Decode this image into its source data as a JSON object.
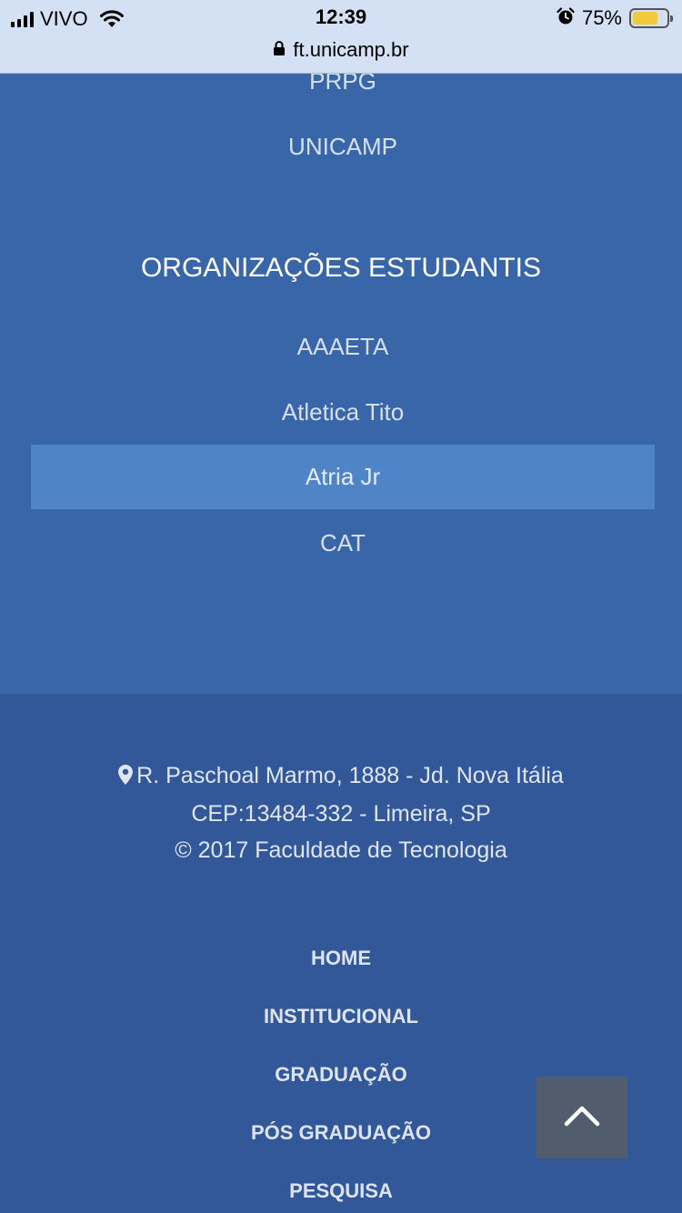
{
  "status_bar": {
    "carrier": "VIVO",
    "time": "12:39",
    "battery_percent": "75%",
    "battery_level": 0.75,
    "url": "ft.unicamp.br"
  },
  "links_section": {
    "top_links": [
      "PRPG",
      "UNICAMP"
    ],
    "heading": "ORGANIZAÇÕES ESTUDANTIS",
    "org_links": [
      "AAAETA",
      "Atletica Tito",
      "Atria Jr",
      "CAT"
    ],
    "active_link": "Atria Jr"
  },
  "footer": {
    "address_line1": "R. Paschoal Marmo, 1888 - Jd. Nova Itália",
    "address_line2": "CEP:13484-332 - Limeira, SP",
    "copyright": "© 2017 Faculdade de Tecnologia",
    "menu": [
      "HOME",
      "INSTITUCIONAL",
      "GRADUAÇÃO",
      "PÓS GRADUAÇÃO",
      "PESQUISA"
    ]
  },
  "icons": {
    "signal": "cellular-signal-icon",
    "wifi": "wifi-icon",
    "alarm": "alarm-icon",
    "lock": "lock-icon",
    "pin": "map-pin-icon",
    "back_to_top": "chevron-up-icon"
  },
  "colors": {
    "section_bg": "#3965a9",
    "footer_bg": "#33589a",
    "active_bg": "#5084c9",
    "statusbar_bg": "#d4e1f4",
    "back_to_top_bg": "#515c6c"
  }
}
